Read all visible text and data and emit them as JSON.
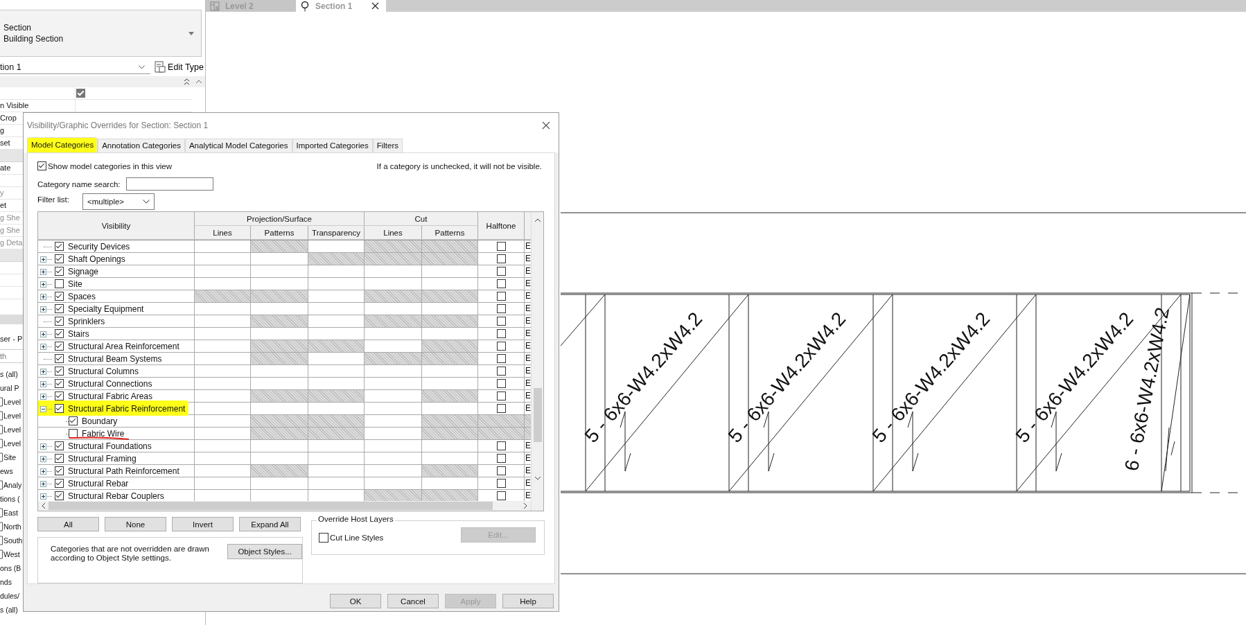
{
  "properties": {
    "type_selector": {
      "family": "Section",
      "type": "Building Section"
    },
    "instance": "tion 1",
    "edit_type": "Edit Type",
    "rows": [
      {
        "kind": "check",
        "checked": true
      },
      {
        "kind": "text",
        "label": "n Visible"
      },
      {
        "kind": "text",
        "label": "Crop"
      },
      {
        "kind": "text",
        "label": "g"
      },
      {
        "kind": "text",
        "label": "set"
      },
      {
        "kind": "group"
      },
      {
        "kind": "text",
        "label": "ate"
      },
      {
        "kind": "text"
      },
      {
        "kind": "disabled",
        "label": "y"
      },
      {
        "kind": "text",
        "label": "et"
      },
      {
        "kind": "disabled",
        "label": "g She"
      },
      {
        "kind": "disabled",
        "label": "g She"
      },
      {
        "kind": "disabled",
        "label": "g Deta"
      },
      {
        "kind": "group"
      },
      {
        "kind": "text"
      },
      {
        "kind": "text"
      },
      {
        "kind": "text"
      }
    ]
  },
  "project_browser": {
    "title": "ser - P",
    "search": {
      "placeholder": "th"
    },
    "items": [
      {
        "kind": "group",
        "label": "s (all)"
      },
      {
        "kind": "group",
        "label": "ural P"
      },
      {
        "kind": "view",
        "label": "Level"
      },
      {
        "kind": "view",
        "label": "Level"
      },
      {
        "kind": "view",
        "label": "Level"
      },
      {
        "kind": "view",
        "label": "Level"
      },
      {
        "kind": "view",
        "label": "Site"
      },
      {
        "kind": "group",
        "label": "ews"
      },
      {
        "kind": "view",
        "label": "Analy"
      },
      {
        "kind": "group",
        "label": "tions ("
      },
      {
        "kind": "view",
        "label": "East"
      },
      {
        "kind": "view",
        "label": "North"
      },
      {
        "kind": "view",
        "label": "South"
      },
      {
        "kind": "view",
        "label": "West"
      },
      {
        "kind": "group",
        "label": "ons (B"
      },
      {
        "kind": "group",
        "label": "nds"
      },
      {
        "kind": "group",
        "label": "dules/"
      },
      {
        "kind": "group",
        "label": "s (all)"
      }
    ]
  },
  "view_tabs": [
    {
      "label": "Level 2",
      "kind": "plan",
      "selected": false
    },
    {
      "label": "Section 1",
      "kind": "section",
      "selected": true
    }
  ],
  "drawing": {
    "tags": [
      "5 - 6x6-W4.2xW4.2",
      "5 - 6x6-W4.2xW4.2",
      "5 - 6x6-W4.2xW4.2",
      "5 - 6x6-W4.2xW4.2",
      "6 - 6x6-W4.2xW4.2"
    ]
  },
  "dialog": {
    "title": "Visibility/Graphic Overrides for Section: Section 1",
    "tabs": [
      {
        "label": "Model Categories",
        "selected": true,
        "highlighted": true
      },
      {
        "label": "Annotation Categories",
        "selected": false,
        "highlighted": false
      },
      {
        "label": "Analytical Model Categories",
        "selected": false,
        "highlighted": false
      },
      {
        "label": "Imported Categories",
        "selected": false,
        "highlighted": false
      },
      {
        "label": "Filters",
        "selected": false,
        "highlighted": false
      }
    ],
    "show_categories": {
      "label": "Show model categories in this view",
      "checked": true
    },
    "hint": "If a category is unchecked, it will not be visible.",
    "search": {
      "label": "Category name search:"
    },
    "filter": {
      "label": "Filter list:",
      "value": "<multiple>"
    },
    "table": {
      "visibility": "Visibility",
      "groups": [
        {
          "label": "Projection/Surface",
          "columns": [
            "Lines",
            "Patterns",
            "Transparency"
          ]
        },
        {
          "label": "Cut",
          "columns": [
            "Lines",
            "Patterns"
          ]
        }
      ],
      "halftone": "Halftone",
      "rows": [
        {
          "name": "Security Devices",
          "checked": true,
          "expandable": false,
          "expanded": false,
          "highlighted": false,
          "underlined": false,
          "shaded": [
            false,
            true,
            false,
            true,
            true,
            false,
            false
          ],
          "halftone": false,
          "column_8": "E"
        },
        {
          "name": "Shaft Openings",
          "checked": true,
          "expandable": true,
          "expanded": false,
          "highlighted": false,
          "underlined": false,
          "shaded": [
            false,
            false,
            true,
            true,
            true,
            false,
            false
          ],
          "halftone": false,
          "column_8": "E"
        },
        {
          "name": "Signage",
          "checked": true,
          "expandable": true,
          "expanded": false,
          "highlighted": false,
          "underlined": false,
          "shaded": [
            false,
            false,
            false,
            false,
            false,
            false,
            false
          ],
          "halftone": false,
          "column_8": "E"
        },
        {
          "name": "Site",
          "checked": false,
          "expandable": true,
          "expanded": false,
          "highlighted": false,
          "underlined": false,
          "shaded": [
            false,
            false,
            false,
            false,
            false,
            false,
            false
          ],
          "halftone": false,
          "column_8": "E"
        },
        {
          "name": "Spaces",
          "checked": true,
          "expandable": true,
          "expanded": false,
          "highlighted": false,
          "underlined": false,
          "shaded": [
            true,
            true,
            false,
            true,
            true,
            false,
            false
          ],
          "halftone": false,
          "column_8": "E"
        },
        {
          "name": "Specialty Equipment",
          "checked": true,
          "expandable": true,
          "expanded": false,
          "highlighted": false,
          "underlined": false,
          "shaded": [
            false,
            false,
            false,
            false,
            false,
            false,
            false
          ],
          "halftone": false,
          "column_8": "E"
        },
        {
          "name": "Sprinklers",
          "checked": true,
          "expandable": false,
          "expanded": false,
          "highlighted": false,
          "underlined": false,
          "shaded": [
            false,
            true,
            false,
            true,
            true,
            false,
            false
          ],
          "halftone": false,
          "column_8": "E"
        },
        {
          "name": "Stairs",
          "checked": true,
          "expandable": true,
          "expanded": false,
          "highlighted": false,
          "underlined": false,
          "shaded": [
            false,
            false,
            false,
            false,
            false,
            false,
            false
          ],
          "halftone": false,
          "column_8": "E"
        },
        {
          "name": "Structural Area Reinforcement",
          "checked": true,
          "expandable": true,
          "expanded": false,
          "highlighted": false,
          "underlined": false,
          "shaded": [
            false,
            true,
            true,
            false,
            true,
            false,
            false
          ],
          "halftone": false,
          "column_8": "E"
        },
        {
          "name": "Structural Beam Systems",
          "checked": true,
          "expandable": false,
          "expanded": false,
          "highlighted": false,
          "underlined": false,
          "shaded": [
            false,
            true,
            false,
            true,
            true,
            false,
            false
          ],
          "halftone": false,
          "column_8": "E"
        },
        {
          "name": "Structural Columns",
          "checked": true,
          "expandable": true,
          "expanded": false,
          "highlighted": false,
          "underlined": false,
          "shaded": [
            false,
            false,
            false,
            false,
            false,
            false,
            false
          ],
          "halftone": false,
          "column_8": "E"
        },
        {
          "name": "Structural Connections",
          "checked": true,
          "expandable": true,
          "expanded": false,
          "highlighted": false,
          "underlined": false,
          "shaded": [
            false,
            false,
            false,
            false,
            false,
            false,
            false
          ],
          "halftone": false,
          "column_8": "E"
        },
        {
          "name": "Structural Fabric Areas",
          "checked": true,
          "expandable": true,
          "expanded": false,
          "highlighted": false,
          "underlined": false,
          "shaded": [
            false,
            true,
            true,
            false,
            true,
            false,
            false
          ],
          "halftone": false,
          "column_8": "E"
        },
        {
          "name": "Structural Fabric Reinforcement",
          "checked": true,
          "expandable": true,
          "expanded": true,
          "highlighted": true,
          "underlined": false,
          "shaded": [
            false,
            false,
            false,
            false,
            false,
            false,
            false
          ],
          "halftone": false,
          "column_8": "E",
          "children": [
            {
              "name": "Boundary",
              "checked": true,
              "highlighted": false,
              "underlined": false,
              "shaded": [
                false,
                true,
                true,
                false,
                true,
                true,
                true
              ]
            },
            {
              "name": "Fabric Wire",
              "checked": false,
              "highlighted": false,
              "underlined": true,
              "shaded": [
                false,
                true,
                true,
                false,
                true,
                true,
                true
              ]
            }
          ]
        },
        {
          "name": "Structural Foundations",
          "checked": true,
          "expandable": true,
          "expanded": false,
          "highlighted": false,
          "underlined": false,
          "shaded": [
            false,
            false,
            false,
            false,
            false,
            false,
            false
          ],
          "halftone": false,
          "column_8": "E"
        },
        {
          "name": "Structural Framing",
          "checked": true,
          "expandable": true,
          "expanded": false,
          "highlighted": false,
          "underlined": false,
          "shaded": [
            false,
            false,
            false,
            false,
            false,
            false,
            false
          ],
          "halftone": false,
          "column_8": "E"
        },
        {
          "name": "Structural Path Reinforcement",
          "checked": true,
          "expandable": true,
          "expanded": false,
          "highlighted": false,
          "underlined": false,
          "shaded": [
            false,
            true,
            false,
            false,
            true,
            false,
            false
          ],
          "halftone": false,
          "column_8": "E"
        },
        {
          "name": "Structural Rebar",
          "checked": true,
          "expandable": true,
          "expanded": false,
          "highlighted": false,
          "underlined": false,
          "shaded": [
            false,
            false,
            false,
            false,
            false,
            false,
            false
          ],
          "halftone": false,
          "column_8": "E"
        },
        {
          "name": "Structural Rebar Couplers",
          "checked": true,
          "expandable": true,
          "expanded": false,
          "highlighted": false,
          "underlined": false,
          "shaded": [
            false,
            false,
            false,
            true,
            true,
            false,
            false
          ],
          "halftone": false,
          "column_8": "E"
        }
      ]
    },
    "row_buttons": [
      "All",
      "None",
      "Invert",
      "Expand All"
    ],
    "note": "Categories that are not overridden are drawn according to Object Style settings.",
    "object_styles": "Object Styles...",
    "host_layers": {
      "title": "Override Host Layers",
      "cut_line_styles": {
        "label": "Cut Line Styles",
        "checked": false
      },
      "edit": {
        "label": "Edit...",
        "disabled": true
      }
    },
    "footer": [
      {
        "label": "OK",
        "disabled": false
      },
      {
        "label": "Cancel",
        "disabled": false
      },
      {
        "label": "Apply",
        "disabled": true
      },
      {
        "label": "Help",
        "disabled": false
      }
    ]
  }
}
